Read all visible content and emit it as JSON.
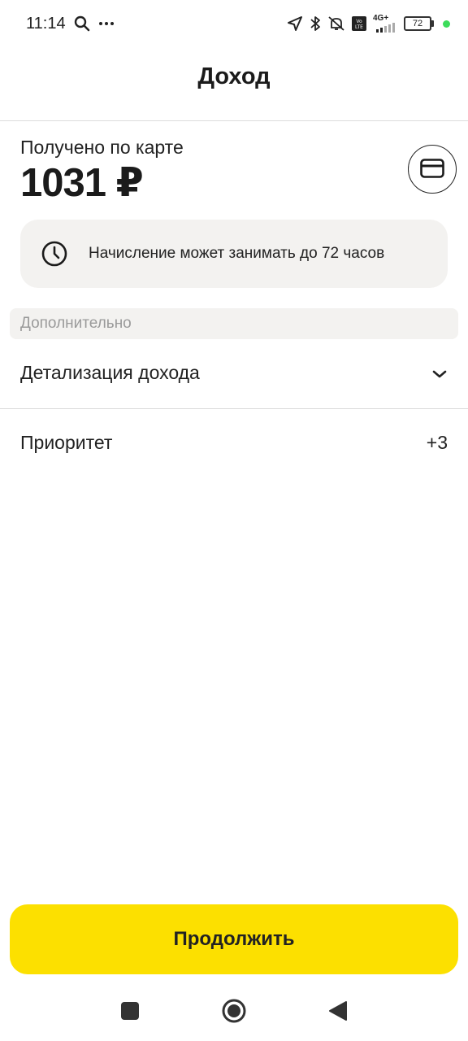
{
  "status_bar": {
    "time": "11:14",
    "battery": "72",
    "network": "4G+",
    "icons": [
      "search-icon",
      "more-dots-icon",
      "location-icon",
      "bluetooth-icon",
      "mute-icon",
      "volte-icon",
      "signal-icon",
      "battery-icon",
      "active-dot"
    ]
  },
  "header": {
    "title": "Доход"
  },
  "summary": {
    "label": "Получено по карте",
    "amount": "1031 ₽",
    "card_icon": "card-icon"
  },
  "notice": {
    "icon": "clock-icon",
    "text": "Начисление может занимать до 72 часов"
  },
  "additional": {
    "header": "Дополнительно",
    "details_label": "Детализация дохода",
    "priority_label": "Приоритет",
    "priority_value": "+3"
  },
  "actions": {
    "continue_label": "Продолжить"
  },
  "nav_bar": {
    "buttons": [
      "recents-button",
      "home-button",
      "back-button"
    ]
  },
  "colors": {
    "accent": "#fce000",
    "notice_bg": "#f3f2f0",
    "text": "#21201f",
    "muted": "#9a9a9a",
    "status_dot": "#3ddc5b"
  }
}
